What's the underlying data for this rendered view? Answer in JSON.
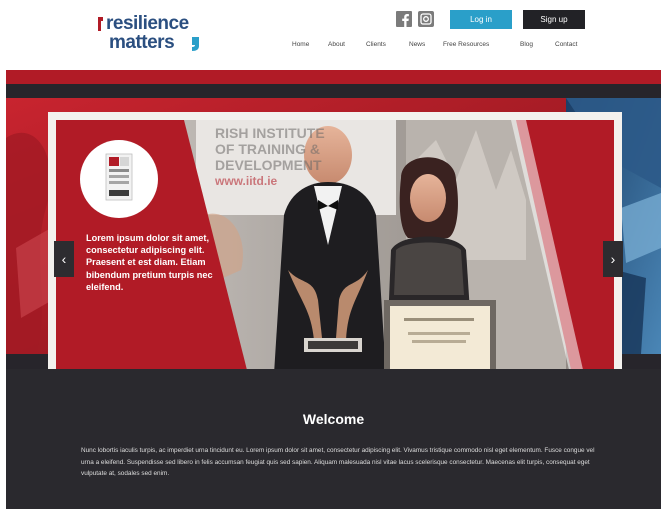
{
  "header": {
    "logo_line1": "resilience",
    "logo_line2": "matters",
    "login_label": "Log in",
    "signup_label": "Sign up"
  },
  "nav": {
    "items": [
      {
        "label": "Home"
      },
      {
        "label": "About"
      },
      {
        "label": "Clients"
      },
      {
        "label": "News"
      },
      {
        "label": "Free Resources"
      },
      {
        "label": "Blog"
      },
      {
        "label": "Contact"
      }
    ]
  },
  "hero": {
    "slide_text": "Lorem ipsum dolor sit amet, consectetur adipiscing elit. Praesent et est diam. Etiam bibendum pretium turpis nec eleifend.",
    "backdrop_lines": [
      "RISH INSTITUTE",
      "OF TRAINING &",
      "DEVELOPMENT",
      "www.iitd.ie"
    ],
    "prev_label": "‹",
    "next_label": "›"
  },
  "welcome": {
    "title": "Welcome",
    "body": "Nunc lobortis iaculis turpis, ac imperdiet urna tincidunt eu. Lorem ipsum dolor sit amet, consectetur adipiscing elit. Vivamus tristique commodo nisl eget elementum. Fusce congue vel urna a eleifend. Suspendisse sed libero in felis accumsan feugiat quis sed sapien. Aliquam malesuada nisl vitae lacus scelerisque consectetur. Maecenas elit turpis, consequat eget vulputate at, sodales sed enim."
  },
  "colors": {
    "brand_red": "#b11b26",
    "brand_blue": "#2b4f80",
    "login_blue": "#2a9fc9",
    "dark": "#2a292e"
  },
  "icons": {
    "facebook": "facebook-icon",
    "instagram": "instagram-icon"
  }
}
